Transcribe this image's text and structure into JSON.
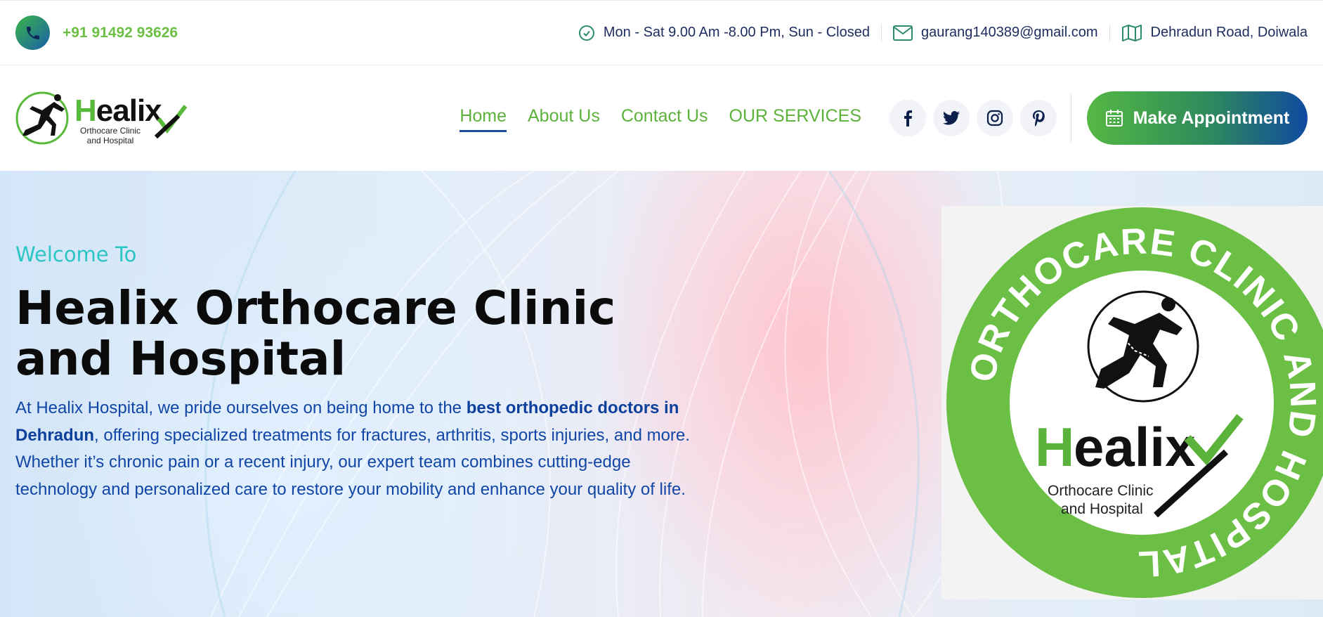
{
  "topbar": {
    "phone": "+91 91492 93626",
    "hours": "Mon - Sat 9.00 Am -8.00 Pm, Sun - Closed",
    "email": "gaurang140389@gmail.com",
    "address": "Dehradun Road, Doiwala"
  },
  "logo": {
    "name_h": "H",
    "name_rest": "ealix",
    "subtitle_line1": "Orthocare Clinic",
    "subtitle_line2": "and Hospital"
  },
  "nav": {
    "items": [
      {
        "label": "Home",
        "active": true
      },
      {
        "label": "About Us"
      },
      {
        "label": "Contact Us"
      },
      {
        "label": "OUR SERVICES"
      }
    ],
    "socials": [
      "facebook-icon",
      "twitter-icon",
      "instagram-icon",
      "pinterest-icon"
    ],
    "appointment_label": "Make Appointment"
  },
  "hero": {
    "welcome": "Welcome To",
    "title": "Healix Orthocare Clinic and Hospital",
    "desc_part1": "At Healix Hospital, we pride ourselves on being home to the ",
    "desc_bold": "best orthopedic doctors in Dehradun",
    "desc_part2": ", offering specialized treatments for fractures, arthritis, sports injuries, and more. Whether it’s chronic pain or a recent injury, our expert team combines cutting-edge technology and personalized care to restore your mobility and enhance your quality of life."
  },
  "badge": {
    "ring_text": "ORTHOCARE CLINIC AND HOSPITAL",
    "name_h": "H",
    "name_rest": "ealix",
    "subtitle_line1": "Orthocare Clinic",
    "subtitle_line2": "and Hospital"
  },
  "colors": {
    "brand_green": "#6cbf45",
    "brand_blue": "#0f4aa0",
    "nav_green": "#5cb33b",
    "welcome_teal": "#2bc5c5",
    "desc_blue": "#1146a6"
  }
}
